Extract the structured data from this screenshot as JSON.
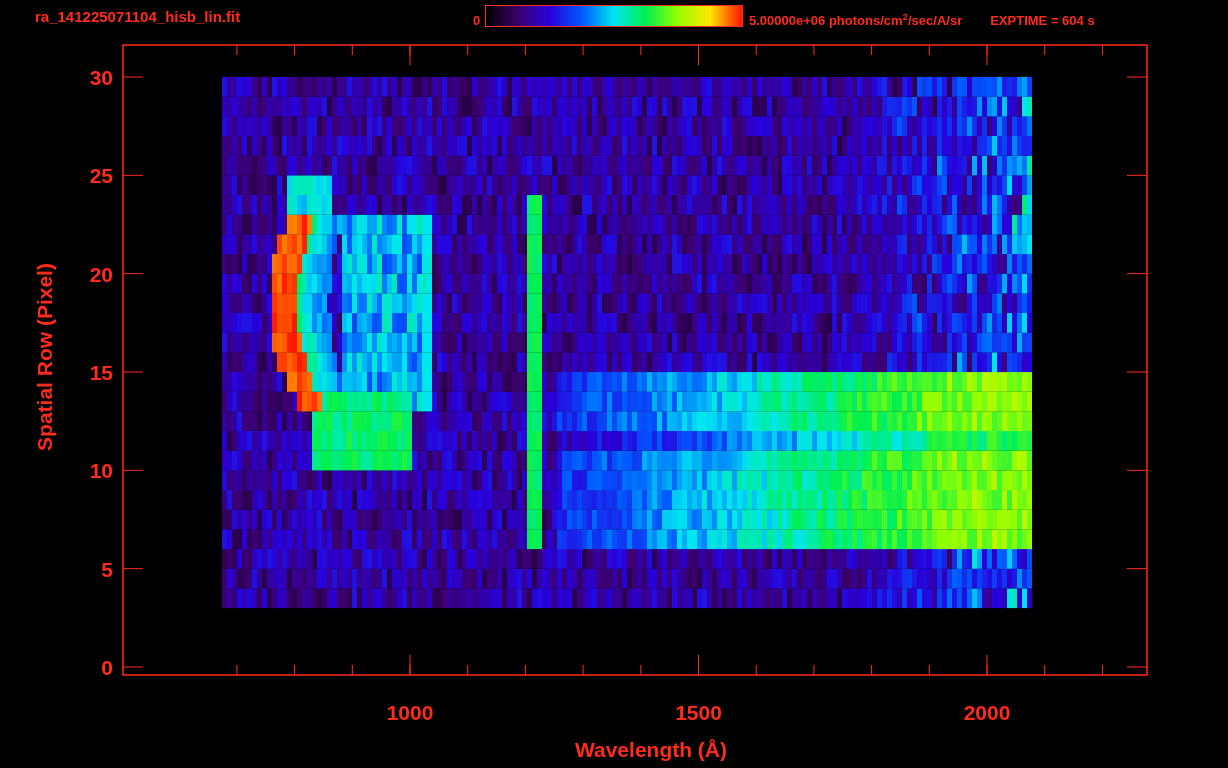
{
  "title": "ra_141225071104_hisb_lin.fit",
  "colorbar": {
    "min_label": "0",
    "max_label": "5.00000e+06 photons/cm$^{2}$/sec/A/sr"
  },
  "exptime": "EXPTIME = 604 s",
  "plot": {
    "x_label": "Wavelength (Å)",
    "y_label": "Spatial Row (Pixel)",
    "x_ticks": [
      "1000",
      "1500",
      "2000"
    ],
    "y_ticks": [
      "30",
      "25",
      "20",
      "15",
      "10",
      "5",
      "0"
    ]
  }
}
